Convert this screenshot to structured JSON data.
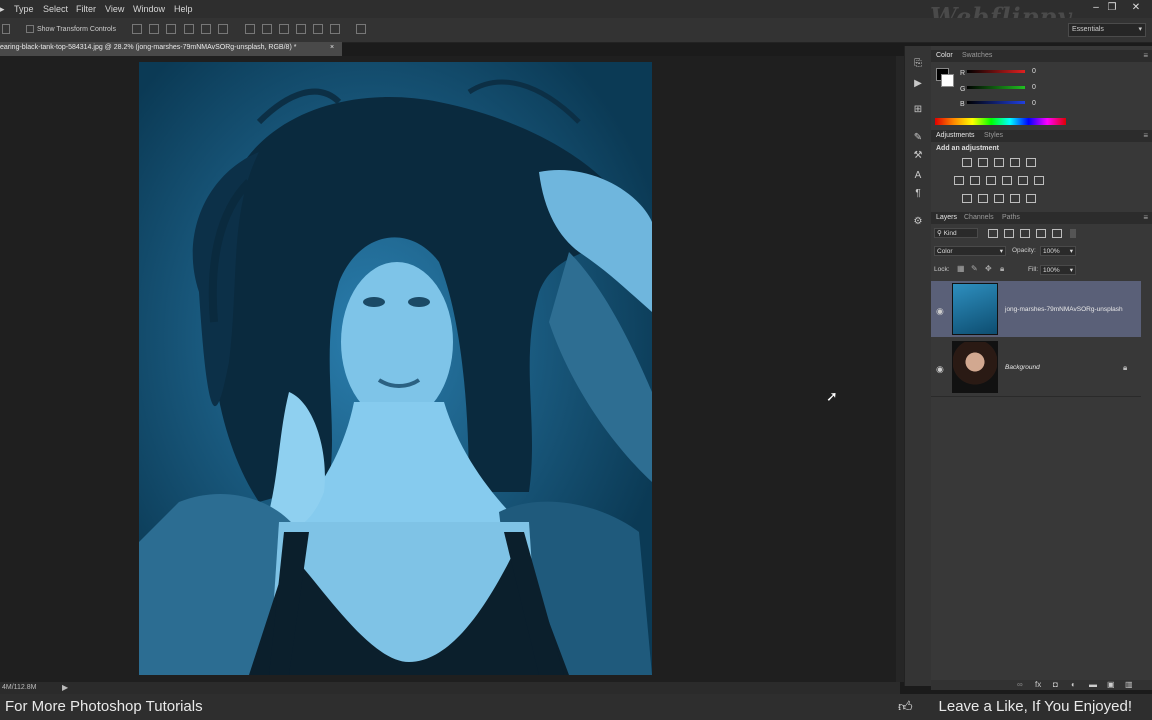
{
  "menu": [
    "Type",
    "Select",
    "Filter",
    "View",
    "Window",
    "Help"
  ],
  "watermark": "Webflippy",
  "options_bar": {
    "show_transform_controls": "Show Transform Controls",
    "workspace": "Essentials"
  },
  "document_tab": {
    "title": "earing-black-tank-top-584314.jpg @ 28.2% (jong-marshes-79mNMAvSORg-unsplash, RGB/8) *",
    "close": "×"
  },
  "status_bar": {
    "doc_size": "4M/112.8M"
  },
  "color_panel": {
    "tabs": [
      "Color",
      "Swatches"
    ],
    "channels": [
      {
        "label": "R",
        "value": "0",
        "color": "#e02020"
      },
      {
        "label": "G",
        "value": "0",
        "color": "#20c020"
      },
      {
        "label": "B",
        "value": "0",
        "color": "#2040e0"
      }
    ]
  },
  "adjustments_panel": {
    "tabs": [
      "Adjustments",
      "Styles"
    ],
    "heading": "Add an adjustment"
  },
  "layers_panel": {
    "tabs": [
      "Layers",
      "Channels",
      "Paths"
    ],
    "filter_kind": "Kind",
    "blend_mode": "Color",
    "opacity_label": "Opacity:",
    "opacity": "100%",
    "lock_label": "Lock:",
    "fill_label": "Fill:",
    "fill": "100%",
    "layers": [
      {
        "name": "jong-marshes-79mNMAvSORg-unsplash",
        "selected": true
      },
      {
        "name": "Background",
        "selected": false
      }
    ]
  },
  "overlay": {
    "left_caption": "For More Photoshop Tutorials",
    "right_caption": "Leave a Like, If You Enjoyed!"
  },
  "colors": {
    "accent_selected_layer": "#5a6078",
    "photo_tint": "#12587c"
  }
}
